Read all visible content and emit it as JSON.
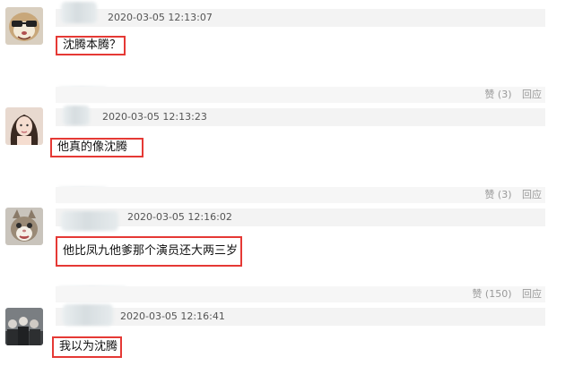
{
  "comments": [
    {
      "timestamp": "2020-03-05 12:13:07",
      "text": "沈腾本腾？",
      "avatar_icon": "cartoon-face-avatar"
    },
    {
      "timestamp": "2020-03-05 12:13:23",
      "text": "他真的像沈腾",
      "avatar_icon": "girl-portrait-avatar",
      "like_label": "赞 (3)",
      "reply_label": "回应"
    },
    {
      "timestamp": "2020-03-05 12:16:02",
      "text": "他比凤九他爹那个演员还大两三岁",
      "avatar_icon": "cat-avatar",
      "like_label": "赞 (3)",
      "reply_label": "回应"
    },
    {
      "timestamp": "2020-03-05 12:16:41",
      "text": "我以为沈腾",
      "avatar_icon": "group-photo-avatar",
      "like_label": "赞 (150)",
      "reply_label": "回应"
    }
  ],
  "colors": {
    "highlight_border": "#e53935",
    "header_bg": "#f3f3f3",
    "muted_text": "#999999"
  }
}
